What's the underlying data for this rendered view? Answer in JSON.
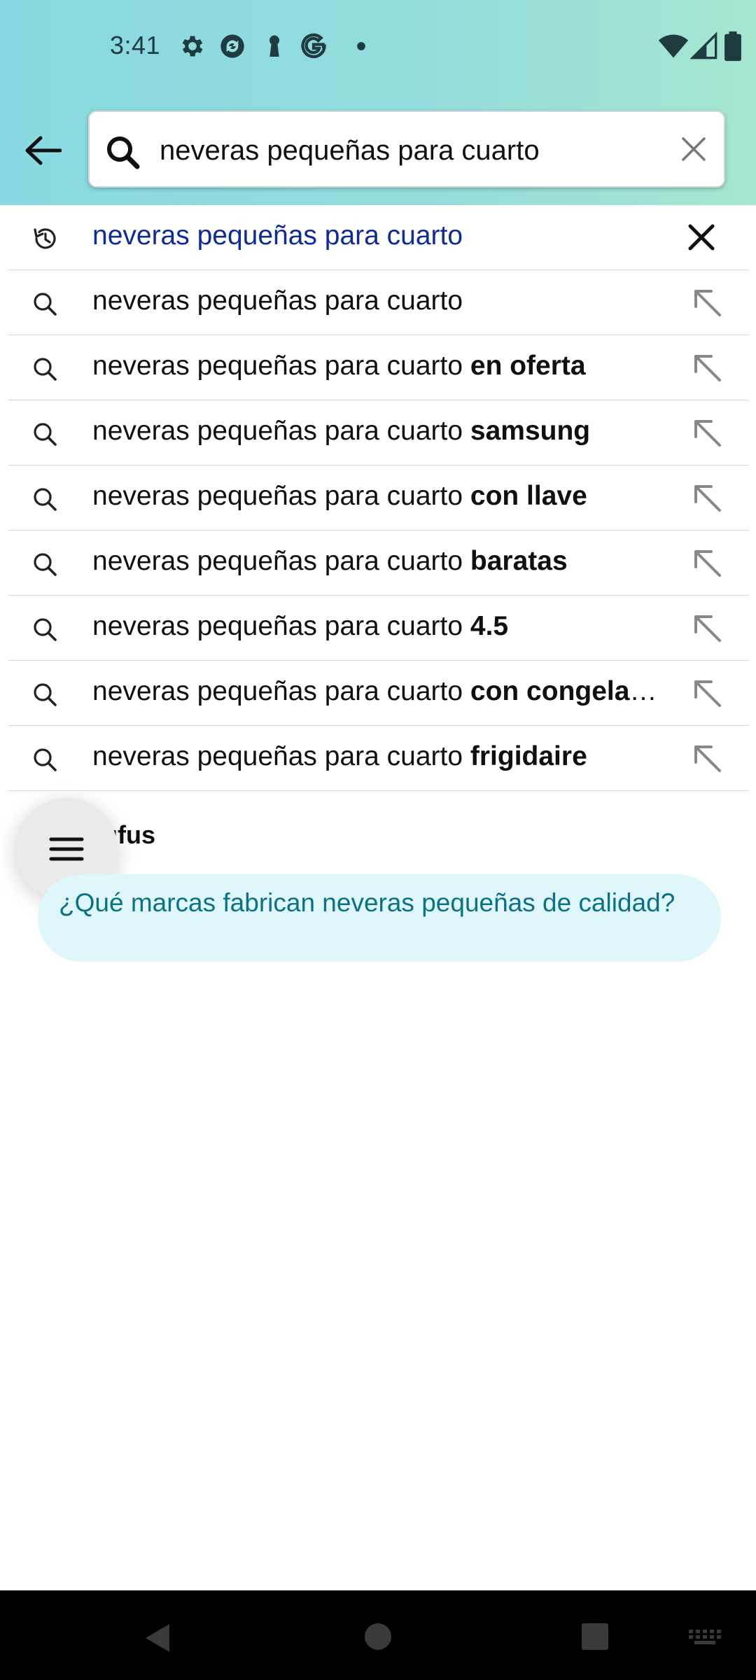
{
  "status_bar": {
    "time": "3:41",
    "icons": [
      "gear-icon",
      "sync-icon",
      "keyhole-icon",
      "google-icon",
      "dot-icon",
      "wifi-icon",
      "signal-icon",
      "battery-icon"
    ]
  },
  "search": {
    "query": "neveras pequeñas para cuarto",
    "placeholder": ""
  },
  "history": {
    "text": "neveras pequeñas para cuarto",
    "color": "#0f2a9a"
  },
  "suggestions": [
    {
      "base": "neveras pequeñas para cuarto",
      "suffix": ""
    },
    {
      "base": "neveras pequeñas para cuarto",
      "suffix": "en oferta"
    },
    {
      "base": "neveras pequeñas para cuarto",
      "suffix": "samsung"
    },
    {
      "base": "neveras pequeñas para cuarto",
      "suffix": "con llave"
    },
    {
      "base": "neveras pequeñas para cuarto",
      "suffix": "baratas"
    },
    {
      "base": "neveras pequeñas para cuarto",
      "suffix": "4.5"
    },
    {
      "base": "neveras pequeñas para cuarto",
      "suffix": "con congelador"
    },
    {
      "base": "neveras pequeñas para cuarto",
      "suffix": "frigidaire"
    }
  ],
  "rufus": {
    "label": "Rufus",
    "question": "¿Qué marcas fabrican neveras pequeñas de calidad?"
  },
  "colors": {
    "header_start": "#88d9e1",
    "header_end": "#a6e6d1",
    "rufus_pill_bg": "#dff6fb",
    "rufus_pill_text": "#0b7285"
  }
}
